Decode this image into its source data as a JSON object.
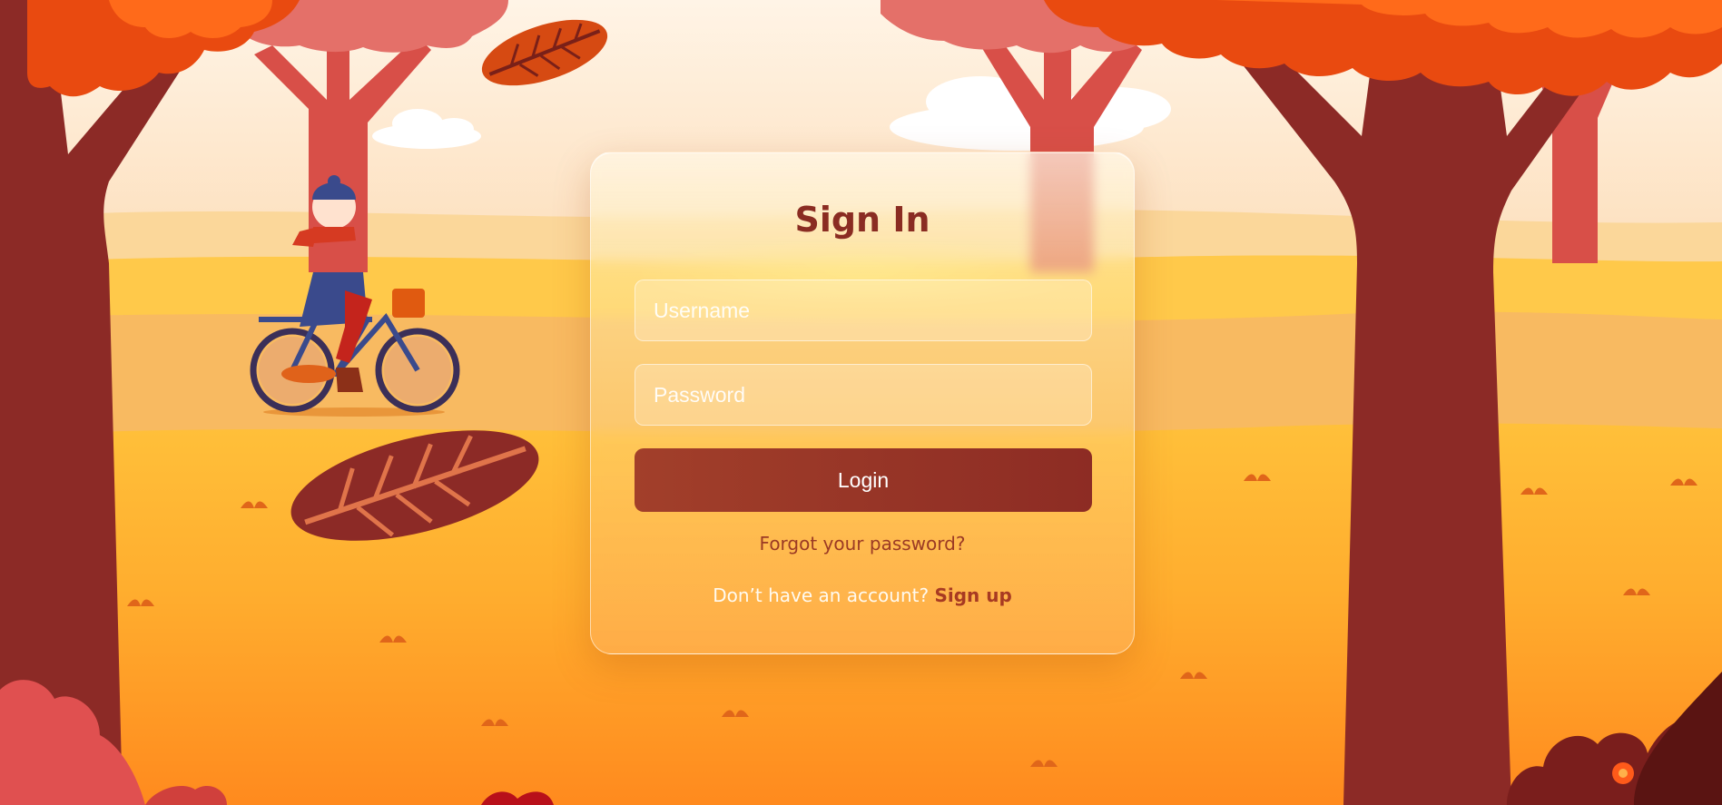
{
  "signin": {
    "title": "Sign In",
    "username_placeholder": "Username",
    "password_placeholder": "Password",
    "login_label": "Login",
    "forgot_label": "Forgot your password?",
    "no_account_text": "Don’t have an account?",
    "signup_label": "Sign up"
  },
  "colors": {
    "accent": "#8d2c24",
    "title": "#8a2c22",
    "link": "#a83a22",
    "sky": "#fdf1e0",
    "ground": "#ff9a2a"
  },
  "icons": [
    "autumn-tree-icon",
    "falling-leaf-icon",
    "bicycle-rider-illustration",
    "cloud-icon",
    "grass-tuft-icon",
    "bush-icon",
    "flower-icon"
  ]
}
